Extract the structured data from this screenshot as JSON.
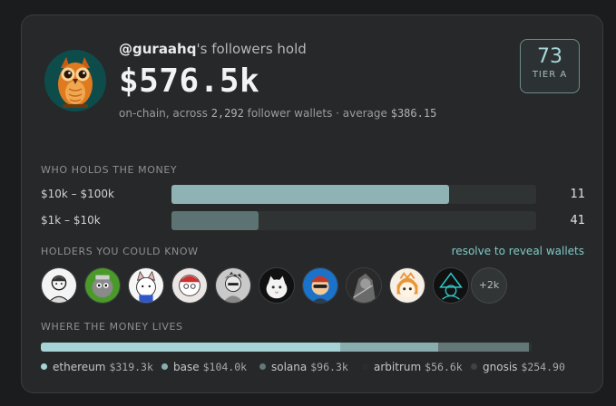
{
  "header": {
    "handle": "@guraahq",
    "title_suffix": "'s followers hold",
    "total": "$576.5k",
    "sub_prefix": "on-chain, across ",
    "wallets": "2,292",
    "sub_middle": " follower wallets · average ",
    "average": "$386.15",
    "avatar_icon": "owl-avatar"
  },
  "score": {
    "value": "73",
    "tier": "TIER A",
    "accent": "#a8d6d8"
  },
  "distribution": {
    "label": "WHO HOLDS THE MONEY",
    "rows": [
      {
        "label": "$10k – $100k",
        "count": "11",
        "fill_fraction": 0.76,
        "color": "#8fb3b4"
      },
      {
        "label": "$1k – $10k",
        "count": "41",
        "fill_fraction": 0.24,
        "color": "#5d7273"
      }
    ]
  },
  "holders": {
    "label": "HOLDERS YOU COULD KNOW",
    "reveal_link": "resolve to reveal wallets",
    "more": "+2k"
  },
  "chains": {
    "label": "WHERE THE MONEY LIVES",
    "items": [
      {
        "name": "ethereum",
        "value": "$319.3k",
        "share": 0.61,
        "color": "#a6d4d6"
      },
      {
        "name": "base",
        "value": "$104.0k",
        "share": 0.2,
        "color": "#8aaeb0"
      },
      {
        "name": "solana",
        "value": "$96.3k",
        "share": 0.185,
        "color": "#637778"
      },
      {
        "name": "arbitrum",
        "value": "$56.6k",
        "share": 0,
        "color": "#2a2c2d"
      },
      {
        "name": "gnosis",
        "value": "$254.90",
        "share": 0,
        "color": "#3e4345"
      }
    ]
  }
}
